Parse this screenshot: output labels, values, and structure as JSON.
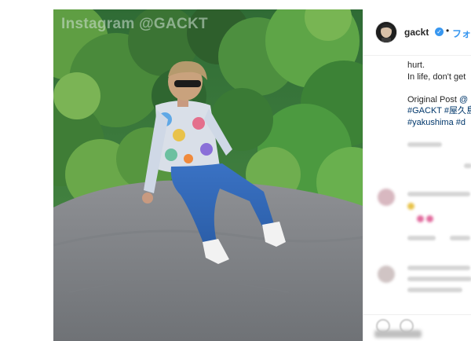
{
  "post": {
    "watermark": "Instagram @GACKT",
    "media_description_icon": "photo-media"
  },
  "header": {
    "username": "gackt",
    "verified_icon": "verified-badge-icon",
    "separator": "•",
    "follow_label": "フォロ"
  },
  "caption": {
    "line1": "hurt.",
    "line2": "In life, don't get",
    "line3_prefix": "Original Post ",
    "line3_link": "@",
    "line4": "#GACKT #屋久島",
    "line5": "#yakushima #d"
  },
  "colors": {
    "link": "#00376b",
    "verified": "#3897f0",
    "follow": "#3897f0",
    "text": "#262626"
  }
}
